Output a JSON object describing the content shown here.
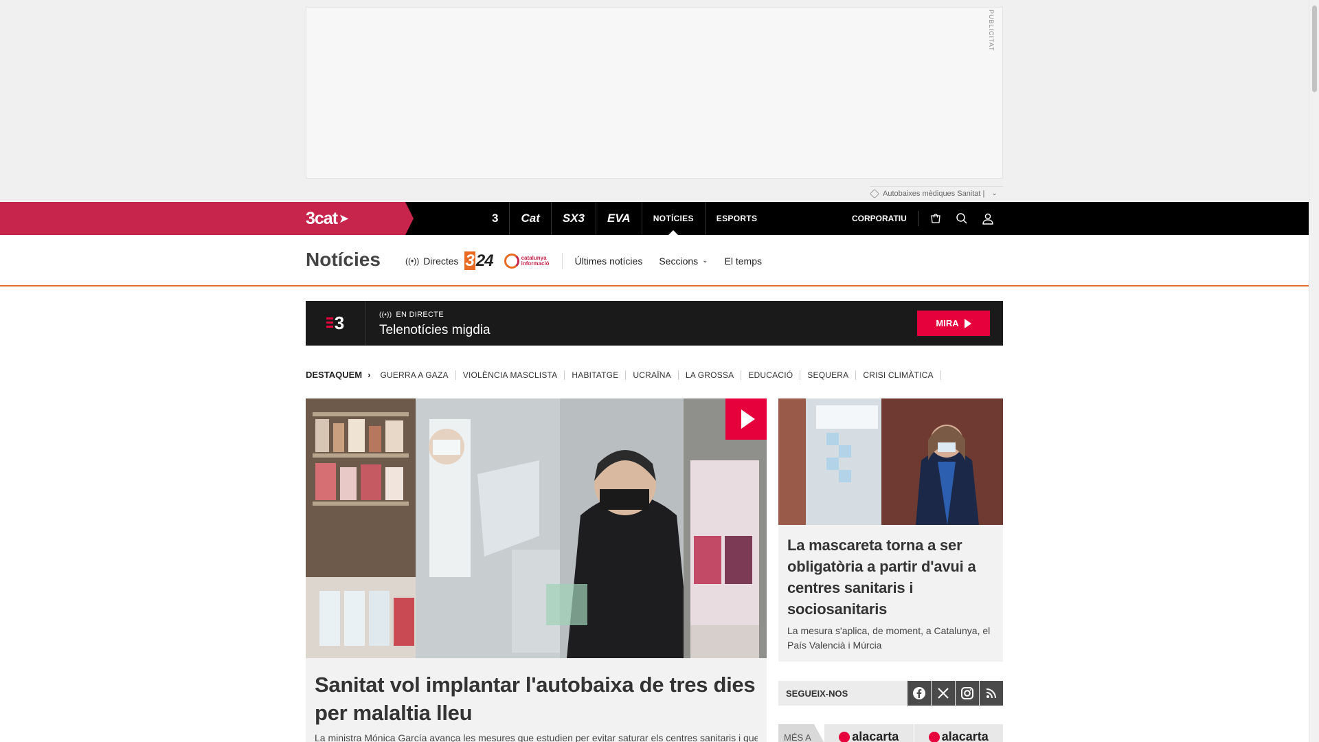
{
  "ad": {
    "label": "PUBLICITAT",
    "tags_text": "Autobaixes mèdiques Sanitat |"
  },
  "topbar": {
    "brand": "3cat",
    "channels": [
      {
        "label": "3",
        "icon": "tv3-logo"
      },
      {
        "label": "Cat",
        "icon": "catradio-logo"
      },
      {
        "label": "SX3",
        "icon": "sx3-logo"
      },
      {
        "label": "EVA",
        "icon": "eva-logo"
      },
      {
        "label": "NOTÍCIES"
      },
      {
        "label": "ESPORTS"
      }
    ],
    "corporatiu": "CORPORATIU",
    "icons": [
      "shop-icon",
      "search-icon",
      "user-icon"
    ]
  },
  "section": {
    "title": "Notícies",
    "directes": "Directes",
    "logo_324": "324",
    "logo_ci": "catalunya informació",
    "links": [
      "Últimes notícies",
      "Seccions",
      "El temps"
    ]
  },
  "live": {
    "channel": "3",
    "status": "EN DIRECTE",
    "program": "Telenotícies migdia",
    "cta": "MIRA"
  },
  "highlights": {
    "title": "DESTAQUEM",
    "items": [
      "GUERRA A GAZA",
      "VIOLÈNCIA MASCLISTA",
      "HABITATGE",
      "UCRAÏNA",
      "LA GROSSA",
      "EDUCACIÓ",
      "SEQUERA",
      "CRISI CLIMÀTICA"
    ]
  },
  "main_article": {
    "title": "Sanitat vol implantar l'autobaixa de tres dies per malaltia lleu",
    "summary": "La ministra Mónica García avança les mesures que estudien per evitar saturar els centres sanitaris i que"
  },
  "side_article": {
    "title": "La mascareta torna a ser obligatòria a partir d'avui a centres sanitaris i sociosanitaris",
    "summary": "La mesura s'aplica, de moment, a Catalunya, el País Valencià i Múrcia"
  },
  "follow": {
    "label": "SEGUEIX-NOS",
    "networks": [
      "facebook-icon",
      "x-icon",
      "instagram-icon",
      "rss-icon"
    ]
  },
  "more": {
    "label": "MÉS A",
    "items": [
      "alacarta",
      "alacarta"
    ]
  },
  "colors": {
    "brand": "#c8254c",
    "accent": "#e96a23",
    "live_red": "#e6003c"
  }
}
